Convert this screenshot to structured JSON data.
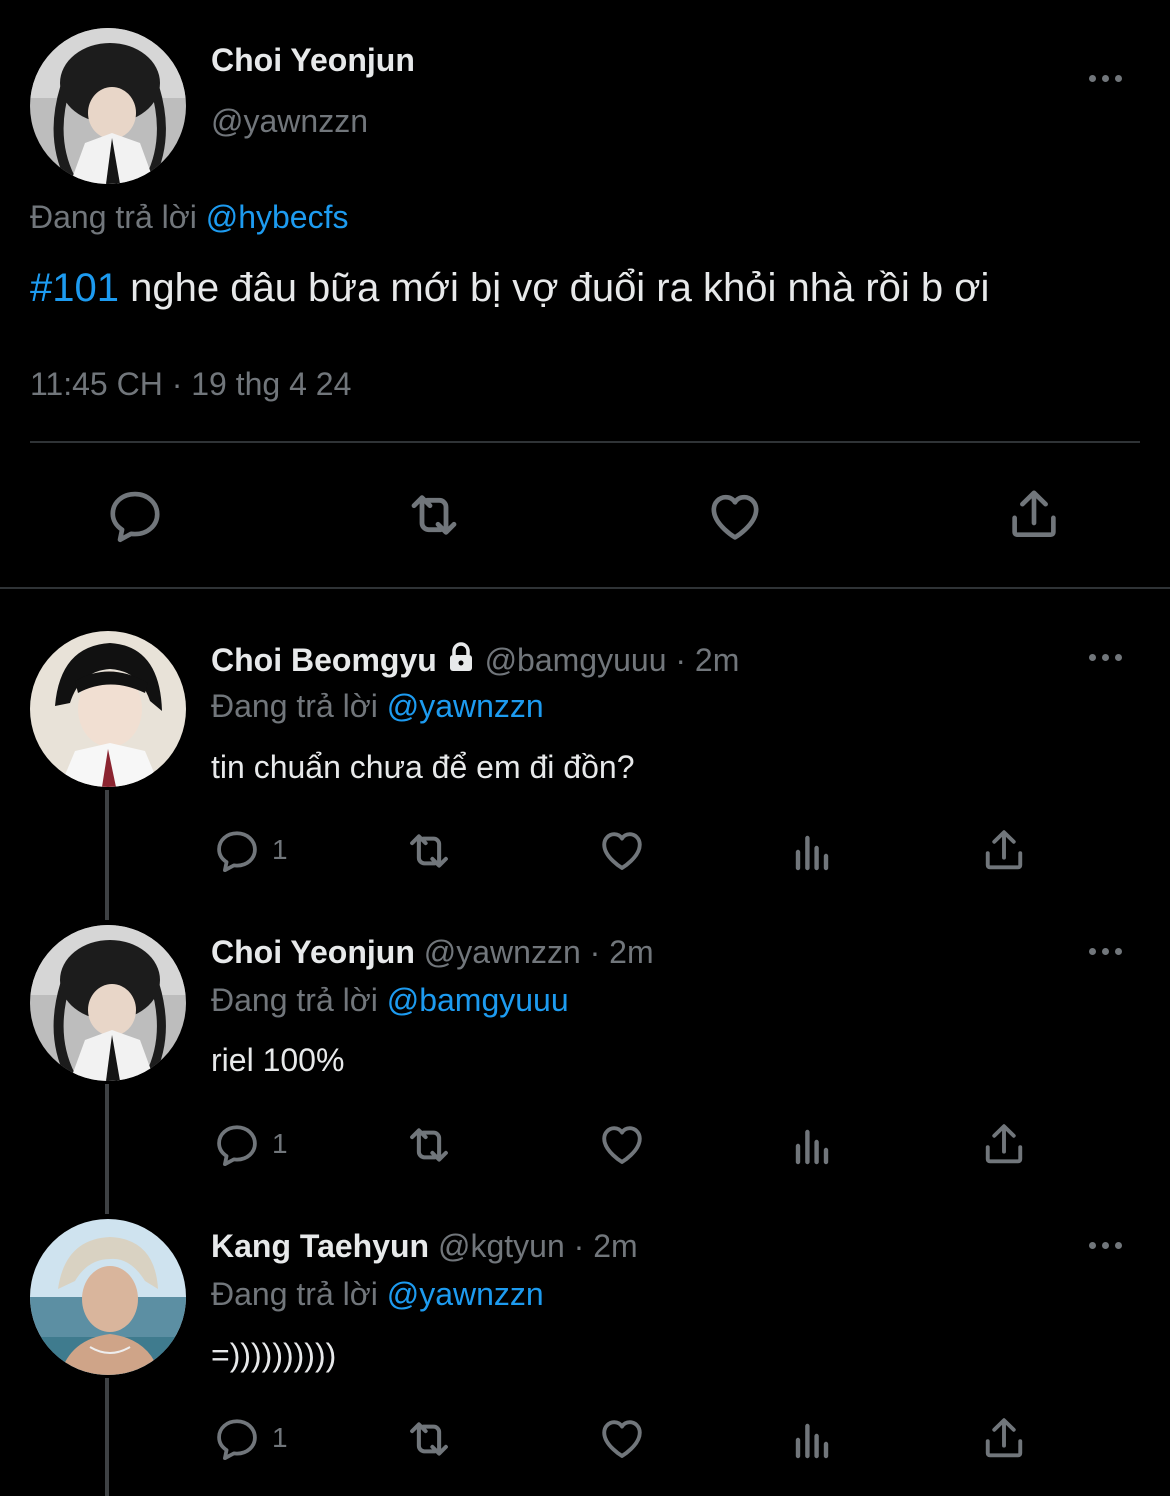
{
  "main_tweet": {
    "author_name": "Choi Yeonjun",
    "author_handle": "@yawnzzn",
    "reply_prefix": "Đang trả lời",
    "reply_to": "@hybecfs",
    "hashtag": "#101",
    "text": " nghe đâu bữa mới bị vợ đuổi ra khỏi nhà rồi b ơi",
    "timestamp": "11:45 CH · 19 thg 4 24"
  },
  "replies": [
    {
      "author_name": "Choi Beomgyu",
      "author_handle": "@bamgyuuu",
      "time": "· 2m",
      "locked": true,
      "reply_prefix": "Đang trả lời",
      "reply_to": "@yawnzzn",
      "text": "tin chuẩn chưa để em đi đồn?",
      "reply_count": "1"
    },
    {
      "author_name": "Choi Yeonjun",
      "author_handle": "@yawnzzn",
      "time": "· 2m",
      "locked": false,
      "reply_prefix": "Đang trả lời",
      "reply_to": "@bamgyuuu",
      "text": "riel 100%",
      "reply_count": "1"
    },
    {
      "author_name": "Kang Taehyun",
      "author_handle": "@kgtyun",
      "time": "· 2m",
      "locked": false,
      "reply_prefix": "Đang trả lời",
      "reply_to": "@yawnzzn",
      "text": "=))))))))))",
      "reply_count": "1"
    }
  ],
  "icons": {
    "reply": "reply-icon",
    "retweet": "retweet-icon",
    "like": "like-icon",
    "views": "views-icon",
    "share": "share-icon",
    "more": "more-icon",
    "lock": "lock-icon"
  },
  "colors": {
    "background": "#000000",
    "text": "#e7e9ea",
    "muted": "#71767b",
    "link": "#1d9bf0"
  }
}
